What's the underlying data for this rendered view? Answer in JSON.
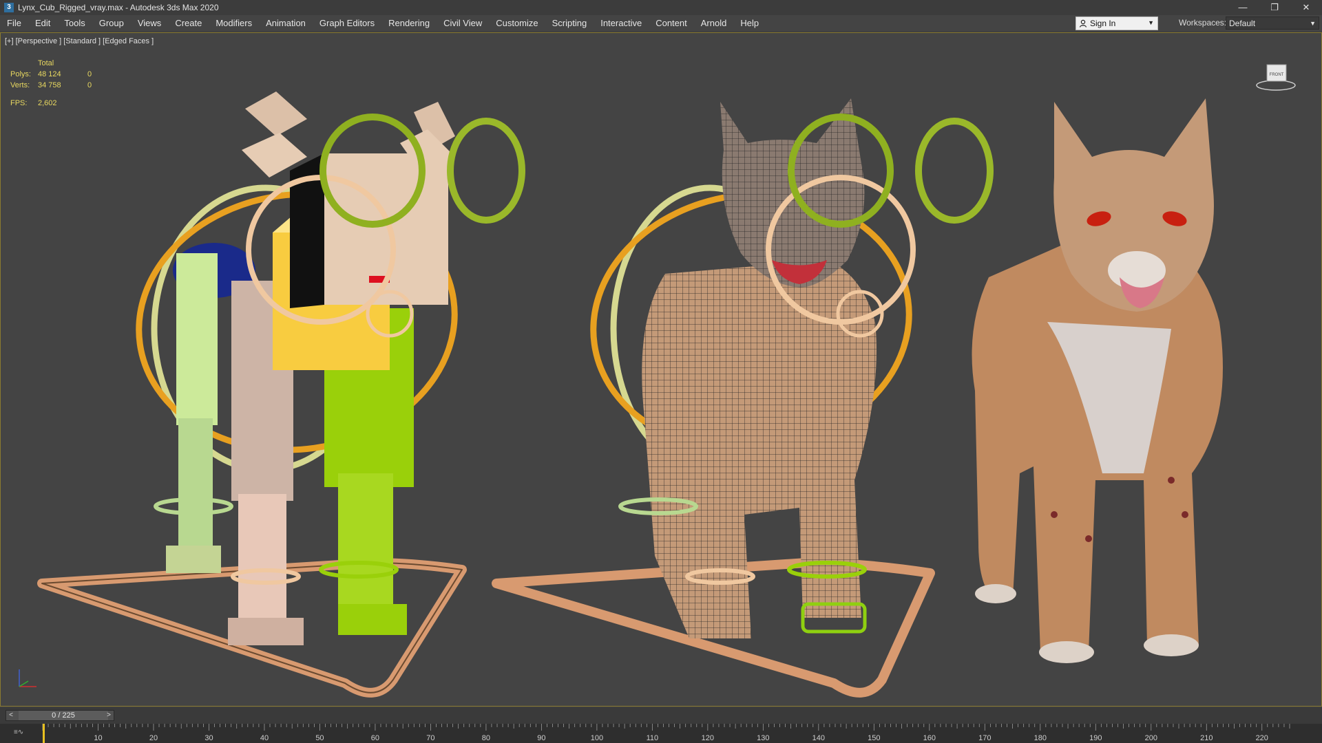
{
  "window": {
    "title": "Lynx_Cub_Rigged_vray.max - Autodesk 3ds Max 2020",
    "app_icon": "3",
    "controls": {
      "minimize": "—",
      "restore": "❐",
      "close": "✕"
    }
  },
  "menu": {
    "items": [
      "File",
      "Edit",
      "Tools",
      "Group",
      "Views",
      "Create",
      "Modifiers",
      "Animation",
      "Graph Editors",
      "Rendering",
      "Civil View",
      "Customize",
      "Scripting",
      "Interactive",
      "Content",
      "Arnold",
      "Help"
    ]
  },
  "account": {
    "sign_in_label": "Sign In",
    "workspaces_label": "Workspaces:",
    "workspace_value": "Default"
  },
  "viewport": {
    "label": "[+] [Perspective ] [Standard ] [Edged Faces ]",
    "stats": {
      "header": "Total",
      "polys_label": "Polys:",
      "polys_value": "48 124",
      "polys_selected": "0",
      "verts_label": "Verts:",
      "verts_value": "34 758",
      "verts_selected": "0",
      "fps_label": "FPS:",
      "fps_value": "2,602"
    },
    "viewcube_label": "FRONT",
    "colors": {
      "background": "#444444",
      "border": "#8a7a30",
      "stats_text": "#e8d860",
      "ring_green": "#9ab82a",
      "ring_orange": "#e8a020",
      "ring_peach": "#f0c8a0",
      "ground": "#d89a70"
    }
  },
  "timeline": {
    "frame_display": "0 / 225",
    "prev_label": "<",
    "next_label": ">",
    "ticks": [
      "10",
      "20",
      "30",
      "40",
      "50",
      "60",
      "70",
      "80",
      "90",
      "100",
      "110",
      "120",
      "130",
      "140",
      "150",
      "160",
      "170",
      "180",
      "190",
      "200",
      "210",
      "220"
    ]
  }
}
